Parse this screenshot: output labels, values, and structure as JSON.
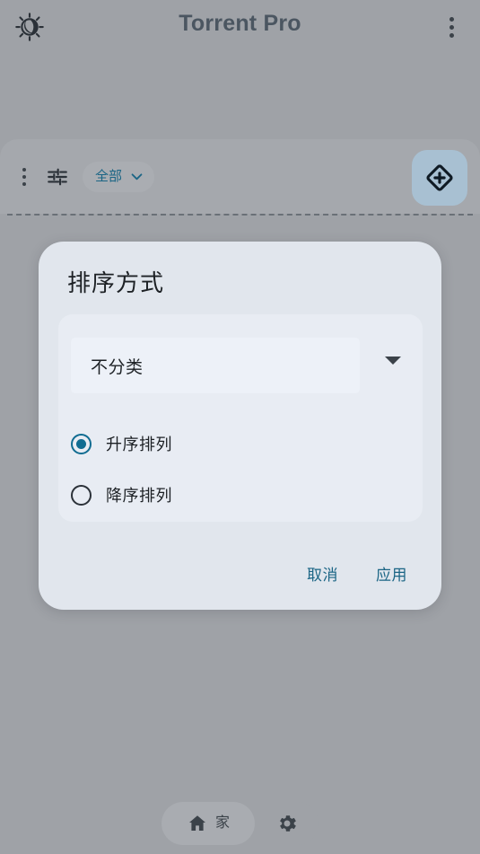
{
  "appbar": {
    "title": "Torrent Pro",
    "theme_toggle_icon": "sun-moon-icon",
    "overflow_icon": "more-vert-icon"
  },
  "toolbar": {
    "overflow_icon": "more-vert-icon",
    "tune_icon": "tune-sliders-icon",
    "filter_chip": {
      "label": "全部",
      "chevron_icon": "chevron-down-icon"
    },
    "fab": {
      "icon": "diamond-plus-icon",
      "background": "#a8c0d2"
    }
  },
  "dialog": {
    "title": "排序方式",
    "select": {
      "value": "不分类",
      "arrow_icon": "dropdown-triangle-icon"
    },
    "radios": [
      {
        "label": "升序排列",
        "selected": true
      },
      {
        "label": "降序排列",
        "selected": false
      }
    ],
    "actions": {
      "cancel_label": "取消",
      "apply_label": "应用"
    }
  },
  "bottom_nav": {
    "items": [
      {
        "label": "家",
        "icon": "home-icon",
        "active": true
      },
      {
        "label": "",
        "icon": "gear-icon",
        "active": false
      }
    ]
  },
  "colors": {
    "background": "#9fa2a7",
    "toolbar_panel": "#a5a8ad",
    "dialog_surface": "#e1e6ed",
    "dialog_card": "#e8ecf3",
    "select_field": "#edf1f8",
    "accent": "#106c91",
    "link": "#1b6585",
    "title_text": "#4b5661",
    "fab_background": "#a8c0d2"
  }
}
